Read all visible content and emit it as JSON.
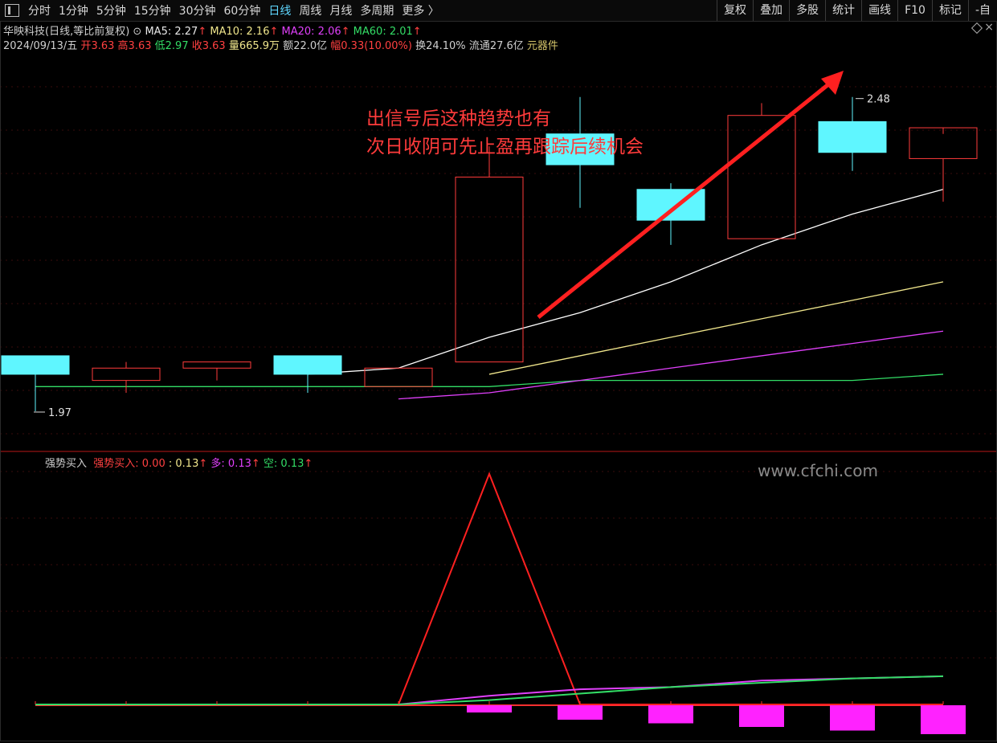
{
  "toolbar": {
    "periods": [
      "分时",
      "1分钟",
      "5分钟",
      "15分钟",
      "30分钟",
      "60分钟",
      "日线",
      "周线",
      "月线",
      "多周期",
      "更多 〉"
    ],
    "active_period": "日线",
    "right_tools": [
      "复权",
      "叠加",
      "多股",
      "统计",
      "画线",
      "F10",
      "标记",
      "-自"
    ]
  },
  "stock": {
    "title": "华映科技(日线,等比前复权)",
    "ma5": "MA5: 2.27",
    "ma10": "MA10: 2.16",
    "ma20": "MA20: 2.06",
    "ma60": "MA60: 2.01",
    "date": "2024/09/13/五",
    "open": "开3.63",
    "high": "高3.63",
    "low": "低2.97",
    "close": "收3.63",
    "volume": "量665.9万",
    "amount": "额22.0亿",
    "change": "幅0.33(10.00%)",
    "turnover": "换24.10%",
    "float_cap": "流通27.6亿",
    "sector": "元器件"
  },
  "annotation": {
    "line1": "出信号后这种趋势也有",
    "line2": "次日收阴可先止盈再跟踪后续机会"
  },
  "price_labels": {
    "high": "2.48",
    "low": "1.97"
  },
  "indicator": {
    "name": "强势买入",
    "buy": "强势买入: 0.00",
    "val": ": 0.13",
    "duo": "多: 0.13",
    "kong": "空: 0.13"
  },
  "watermark": "www.cfchi.com",
  "colors": {
    "up": "#ff3b3b",
    "down": "#5ff6ff",
    "ma5": "#ffffff",
    "ma10": "#f0e68c",
    "ma20": "#e040fb",
    "ma60": "#33dd66",
    "bar": "#ff22ff"
  },
  "chart_data": {
    "type": "candlestick",
    "candles": [
      {
        "o": 2.06,
        "h": 2.06,
        "l": 1.97,
        "c": 2.03,
        "dir": "down"
      },
      {
        "o": 2.02,
        "h": 2.05,
        "l": 2.0,
        "c": 2.04,
        "dir": "up"
      },
      {
        "o": 2.04,
        "h": 2.05,
        "l": 2.02,
        "c": 2.05,
        "dir": "up"
      },
      {
        "o": 2.06,
        "h": 2.06,
        "l": 2.0,
        "c": 2.03,
        "dir": "down"
      },
      {
        "o": 2.01,
        "h": 2.04,
        "l": 2.01,
        "c": 2.04,
        "dir": "up"
      },
      {
        "o": 2.05,
        "h": 2.4,
        "l": 2.05,
        "c": 2.35,
        "dir": "up"
      },
      {
        "o": 2.42,
        "h": 2.48,
        "l": 2.3,
        "c": 2.37,
        "dir": "down"
      },
      {
        "o": 2.33,
        "h": 2.34,
        "l": 2.24,
        "c": 2.28,
        "dir": "down"
      },
      {
        "o": 2.25,
        "h": 2.47,
        "l": 2.25,
        "c": 2.45,
        "dir": "up"
      },
      {
        "o": 2.44,
        "h": 2.48,
        "l": 2.36,
        "c": 2.39,
        "dir": "down"
      },
      {
        "o": 2.38,
        "h": 2.42,
        "l": 2.31,
        "c": 2.43,
        "dir": "up"
      }
    ],
    "ma5": [
      null,
      null,
      null,
      2.03,
      2.04,
      2.09,
      2.13,
      2.18,
      2.24,
      2.29,
      2.33
    ],
    "ma10": [
      null,
      null,
      null,
      null,
      null,
      2.03,
      2.06,
      2.09,
      2.12,
      2.15,
      2.18
    ],
    "ma20": [
      null,
      null,
      null,
      null,
      1.99,
      2.0,
      2.02,
      2.04,
      2.06,
      2.08,
      2.1
    ],
    "ma60": [
      2.01,
      2.01,
      2.01,
      2.01,
      2.01,
      2.01,
      2.02,
      2.02,
      2.02,
      2.02,
      2.03
    ],
    "indicator_bars": [
      0,
      0,
      0,
      0,
      0,
      -0.02,
      -0.04,
      -0.05,
      -0.06,
      -0.07,
      -0.08
    ],
    "buy_signal": [
      0,
      0,
      0,
      0,
      0,
      1,
      0,
      0,
      0,
      0,
      0
    ],
    "duo": [
      0,
      0,
      0,
      0,
      0,
      0.04,
      0.07,
      0.08,
      0.11,
      0.12,
      0.13
    ],
    "kong": [
      0,
      0,
      0,
      0,
      0,
      0.02,
      0.05,
      0.08,
      0.1,
      0.12,
      0.13
    ]
  }
}
